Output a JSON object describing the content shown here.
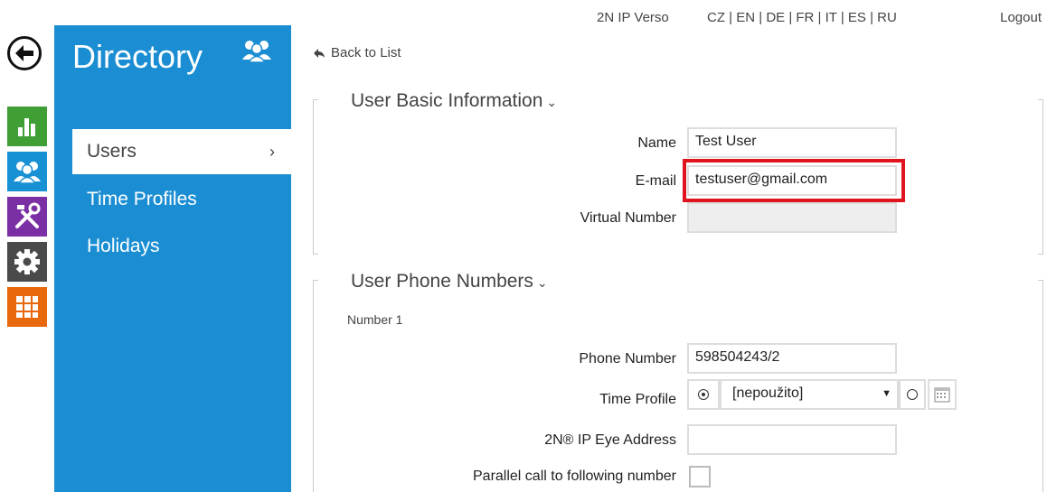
{
  "topbar": {
    "device": "2N IP Verso",
    "languages": [
      "CZ",
      "EN",
      "DE",
      "FR",
      "IT",
      "ES",
      "RU"
    ],
    "logout": "Logout"
  },
  "panel": {
    "title": "Directory",
    "nav": [
      {
        "label": "Users",
        "active": true
      },
      {
        "label": "Time Profiles",
        "active": false
      },
      {
        "label": "Holidays",
        "active": false
      }
    ]
  },
  "rail": [
    "status-icon",
    "directory-icon",
    "hardware-icon",
    "system-icon",
    "services-icon"
  ],
  "main": {
    "back_label": "Back to List",
    "basic": {
      "title": "User Basic Information",
      "name_label": "Name",
      "name_value": "Test User",
      "email_label": "E-mail",
      "email_value": "testuser@gmail.com",
      "virtual_label": "Virtual Number",
      "virtual_value": ""
    },
    "phones": {
      "title": "User Phone Numbers",
      "number_heading": "Number 1",
      "phone_label": "Phone Number",
      "phone_value": "598504243/2",
      "time_profile_label": "Time Profile",
      "time_profile_value": "[nepoužito]",
      "eye_label": "2N® IP Eye Address",
      "eye_value": "",
      "parallel_label": "Parallel call to following number"
    }
  },
  "colors": {
    "panel_blue": "#1b8ed3",
    "highlight_red": "#e0141e",
    "status_green": "#3f9e34",
    "hardware_purple": "#7b2fa5",
    "services_orange": "#e8680e"
  }
}
